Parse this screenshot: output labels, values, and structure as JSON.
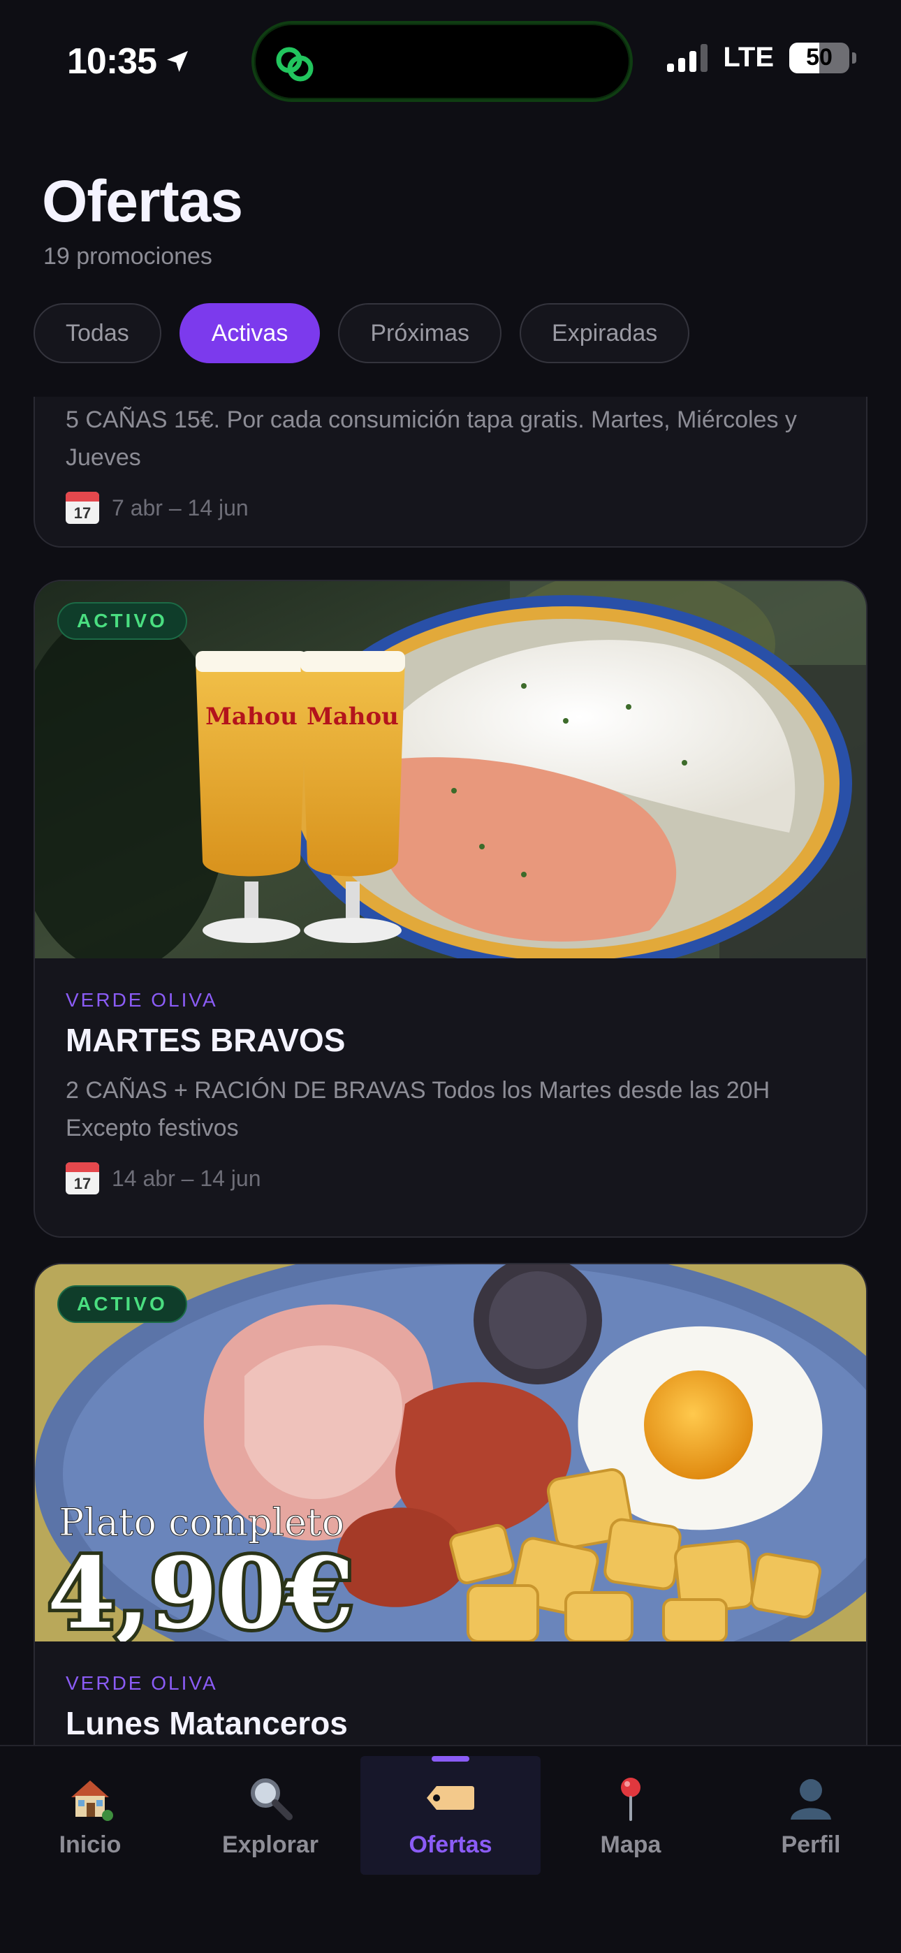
{
  "status_bar": {
    "time": "10:35",
    "network": "LTE",
    "battery": "50"
  },
  "header": {
    "title": "Ofertas",
    "subtitle": "19 promociones"
  },
  "filters": [
    {
      "label": "Todas",
      "active": false
    },
    {
      "label": "Activas",
      "active": true
    },
    {
      "label": "Próximas",
      "active": false
    },
    {
      "label": "Expiradas",
      "active": false
    }
  ],
  "offers": [
    {
      "description": "5 CAÑAS 15€. Por cada consumición tapa gratis. Martes, Miércoles y Jueves",
      "dates": "7 abr – 14 jun",
      "calendar_day": "17"
    },
    {
      "badge": "ACTIVO",
      "venue": "VERDE OLIVA",
      "title": "MARTES BRAVOS",
      "description": "2 CAÑAS + RACIÓN DE BRAVAS Todos los Martes desde las 20H Excepto festivos",
      "dates": "14 abr – 14 jun",
      "calendar_day": "17",
      "image_text": {
        "brand": "Mahou"
      }
    },
    {
      "badge": "ACTIVO",
      "venue": "VERDE OLIVA",
      "title": "Lunes Matanceros",
      "image_text": {
        "caption": "Plato completo",
        "price": "4,90€"
      }
    }
  ],
  "tabs": [
    {
      "label": "Inicio",
      "icon": "house-icon",
      "active": false
    },
    {
      "label": "Explorar",
      "icon": "magnifier-icon",
      "active": false
    },
    {
      "label": "Ofertas",
      "icon": "tag-icon",
      "active": true
    },
    {
      "label": "Mapa",
      "icon": "pin-icon",
      "active": false
    },
    {
      "label": "Perfil",
      "icon": "person-icon",
      "active": false
    }
  ],
  "colors": {
    "accent": "#7c3aed",
    "active_badge": "#4ade80",
    "background": "#0e0e14"
  }
}
